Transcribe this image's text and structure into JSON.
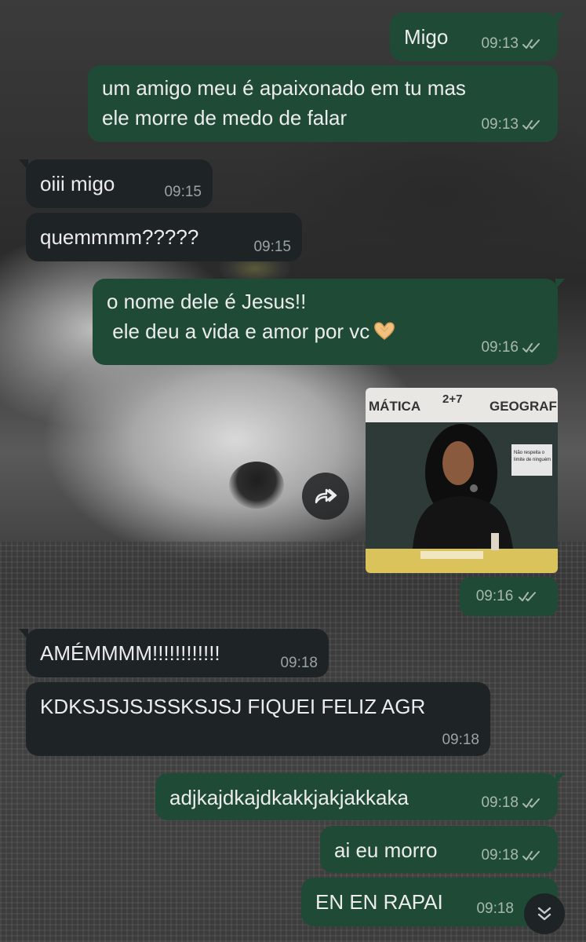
{
  "colors": {
    "outgoing_bubble": "#1f4b36",
    "incoming_bubble": "#1e2326",
    "text": "#ececec",
    "timestamp": "#a9b8af",
    "read_ticks": "#a9b8af"
  },
  "messages": [
    {
      "direction": "out",
      "text": "Migo",
      "time": "09:13",
      "status": "read"
    },
    {
      "direction": "out",
      "text": "um amigo meu é apaixonado em tu mas\nele morre de medo de falar",
      "time": "09:13",
      "status": "read"
    },
    {
      "direction": "in",
      "text": "oiii migo",
      "time": "09:15"
    },
    {
      "direction": "in",
      "text": "quemmmm?????",
      "time": "09:15"
    },
    {
      "direction": "out",
      "text": "o nome dele é Jesus!!\n ele deu a vida e amor por vc",
      "emoji": "heart-hands",
      "time": "09:16",
      "status": "read"
    },
    {
      "direction": "out",
      "type": "gif",
      "time": "09:16",
      "status": "read",
      "image": {
        "board_left": "MÁTICA",
        "board_center": "2+7",
        "board_right": "GEOGRAFIA",
        "sign_line1": "Não respeita o",
        "sign_line2": "limite de ninguém"
      }
    },
    {
      "direction": "in",
      "text": "AMÉMMMM!!!!!!!!!!!!",
      "time": "09:18"
    },
    {
      "direction": "in",
      "text": "KDKSJSJSJSSKSJSJ FIQUEI FELIZ AGR",
      "time": "09:18"
    },
    {
      "direction": "out",
      "text": "adjkajdkajdkakkjakjakkaka",
      "time": "09:18",
      "status": "read"
    },
    {
      "direction": "out",
      "text": "ai eu morro",
      "time": "09:18",
      "status": "read"
    },
    {
      "direction": "out",
      "text": "EN EN RAPAI",
      "time": "09:18"
    }
  ],
  "controls": {
    "forward_icon": "forward-icon",
    "scroll_down_icon": "double-chevron-down-icon"
  }
}
